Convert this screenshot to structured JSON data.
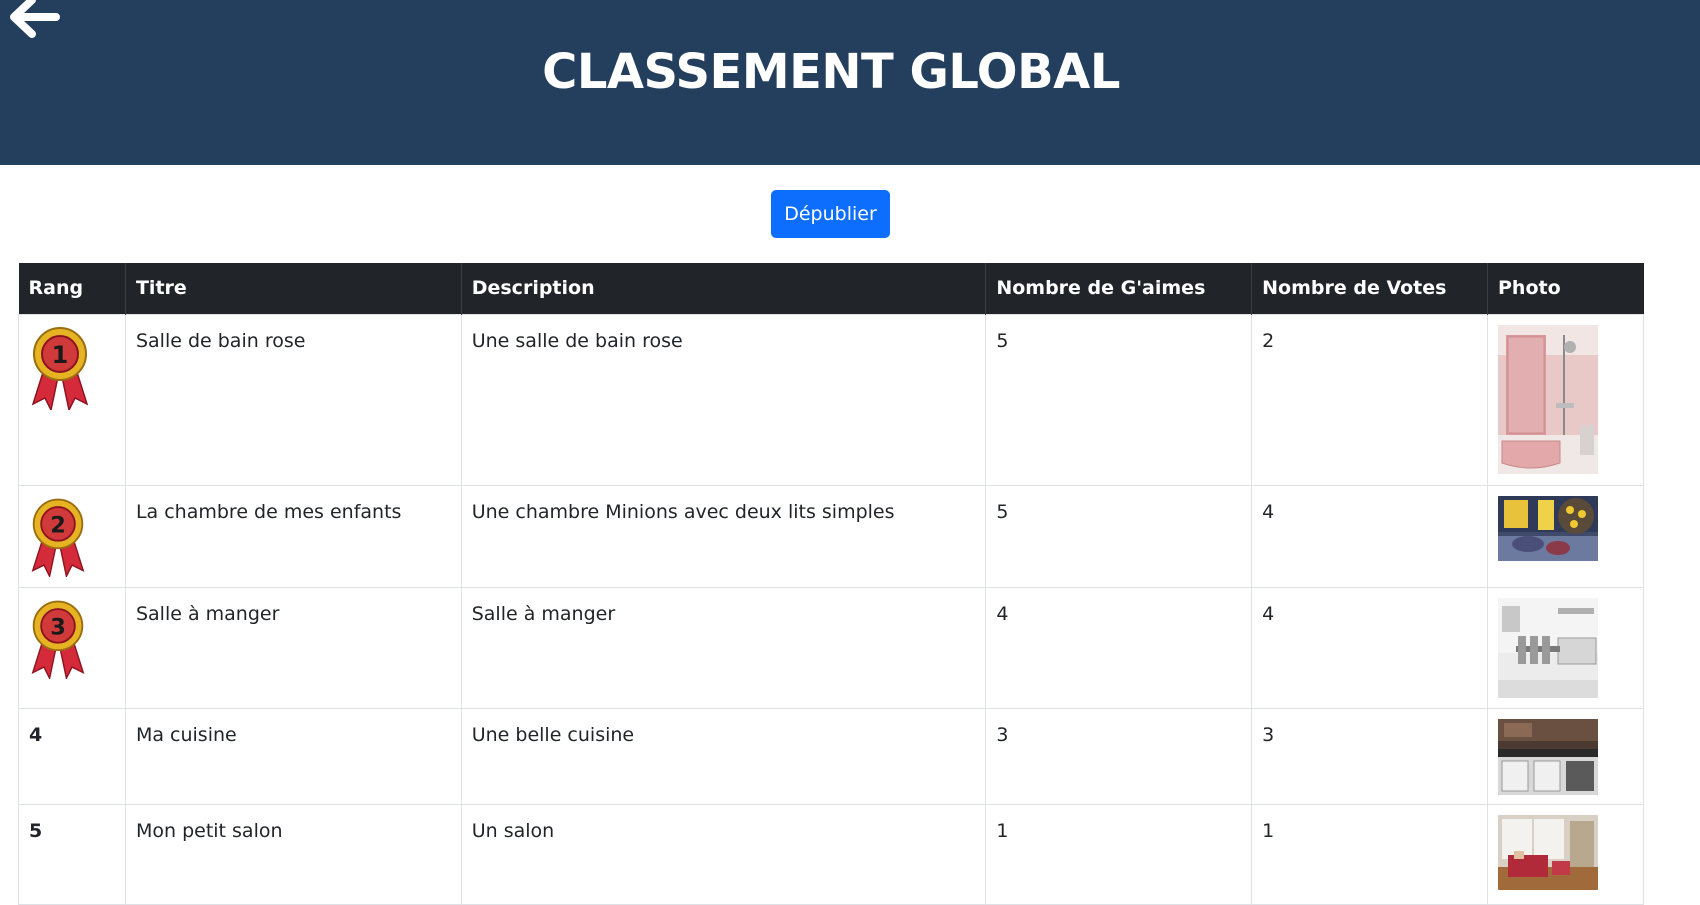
{
  "header": {
    "title": "CLASSEMENT GLOBAL",
    "back_icon": "arrow-left-icon"
  },
  "actions": {
    "unpublish_label": "Dépublier"
  },
  "table": {
    "columns": [
      "Rang",
      "Titre",
      "Description",
      "Nombre de G'aimes",
      "Nombre de Votes",
      "Photo"
    ],
    "rows": [
      {
        "rank": "1",
        "medal": "gold-medal-icon",
        "title": "Salle de bain rose",
        "description": "Une salle de bain rose",
        "likes": "5",
        "votes": "2",
        "photo": "pink-bathroom-photo"
      },
      {
        "rank": "2",
        "medal": "silver-medal-icon",
        "title": "La chambre de mes enfants",
        "description": "Une chambre Minions avec deux lits simples",
        "likes": "5",
        "votes": "4",
        "photo": "minions-bedroom-photo"
      },
      {
        "rank": "3",
        "medal": "bronze-medal-icon",
        "title": "Salle à manger",
        "description": "Salle à manger",
        "likes": "4",
        "votes": "4",
        "photo": "dining-room-photo"
      },
      {
        "rank": "4",
        "title": "Ma cuisine",
        "description": "Une belle cuisine",
        "likes": "3",
        "votes": "3",
        "photo": "kitchen-photo"
      },
      {
        "rank": "5",
        "title": "Mon petit salon",
        "description": "Un salon",
        "likes": "1",
        "votes": "1",
        "photo": "living-room-photo"
      }
    ]
  },
  "colors": {
    "header_bg": "#243f5e",
    "table_head_bg": "#212529",
    "button_bg": "#0d6efd",
    "medal_gold": "#e6b422",
    "ribbon_red": "#d42a3a"
  }
}
